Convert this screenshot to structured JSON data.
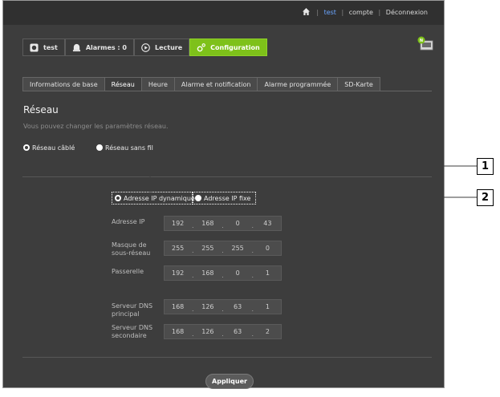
{
  "header": {
    "user": "test",
    "separator": "|",
    "account": "compte",
    "logout": "Déconnexion"
  },
  "nav": {
    "live": "test",
    "alarms": "Alarmes : 0",
    "playback": "Lecture",
    "config": "Configuration"
  },
  "tabs": [
    "Informations de base",
    "Réseau",
    "Heure",
    "Alarme et notification",
    "Alarme programmée",
    "SD-Karte"
  ],
  "page": {
    "title": "Réseau",
    "subtitle": "Vous pouvez changer les paramètres réseau."
  },
  "connection": {
    "wired": "Réseau câblé",
    "wireless": "Réseau sans fil"
  },
  "ip_mode": {
    "dynamic": "Adresse IP dynamique",
    "fixed": "Adresse IP fixe"
  },
  "fields": {
    "ip": {
      "label": "Adresse IP",
      "octets": [
        "192",
        "168",
        "0",
        "43"
      ]
    },
    "mask": {
      "label": "Masque de sous-réseau",
      "octets": [
        "255",
        "255",
        "255",
        "0"
      ]
    },
    "gateway": {
      "label": "Passerelle",
      "octets": [
        "192",
        "168",
        "0",
        "1"
      ]
    },
    "dns1": {
      "label": "Serveur DNS principal",
      "octets": [
        "168",
        "126",
        "63",
        "1"
      ]
    },
    "dns2": {
      "label": "Serveur DNS secondaire",
      "octets": [
        "168",
        "126",
        "63",
        "2"
      ]
    },
    "dot": "."
  },
  "apply_label": "Appliquer",
  "callouts": {
    "one": "1",
    "two": "2"
  },
  "colors": {
    "accent": "#7ec11a",
    "link": "#6aa5ff",
    "background": "#3d3d3d"
  }
}
